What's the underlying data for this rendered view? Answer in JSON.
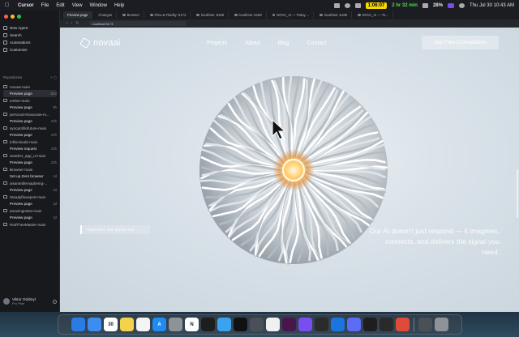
{
  "menubar": {
    "app_name": "Cursor",
    "items": [
      "File",
      "Edit",
      "View",
      "Window",
      "Help"
    ],
    "timer_yellow": "1:06:07",
    "timer_green": "2 hr 32 min",
    "battery_pct": "28%",
    "clock": "Thu Jul 30  10:43 AM"
  },
  "sidebar": {
    "nav": [
      {
        "label": "New Agent",
        "icon": "plus-icon"
      },
      {
        "label": "Search",
        "icon": "search-icon"
      },
      {
        "label": "Automations",
        "icon": "automation-icon"
      },
      {
        "label": "Customize",
        "icon": "customize-icon"
      }
    ],
    "repos_label": "Repositories",
    "repos": [
      {
        "name": "novaai-main",
        "sub": "Preview page",
        "age": "15m",
        "active": true
      },
      {
        "name": "ember-main",
        "sub": "Preview page",
        "age": "8h",
        "active": false
      },
      {
        "name": "personal-showcase-m...",
        "sub": "Preview page",
        "age": "22h",
        "active": false
      },
      {
        "name": "syncprofilofuture-main",
        "sub": "Preview page",
        "age": "22h",
        "active": false
      },
      {
        "name": "infiniclouds-main",
        "sub": "Preview request",
        "age": "22h",
        "active": false
      },
      {
        "name": "weather_app_ui-main",
        "sub": "Preview page",
        "age": "22h",
        "active": false
      },
      {
        "name": "Browser-main",
        "sub": "Set up Zero browser",
        "age": "1d",
        "active": false
      },
      {
        "name": "aisantedlemapbeing-...",
        "sub": "Preview page",
        "age": "2d",
        "active": false
      },
      {
        "name": "Steadyflowsport-main",
        "sub": "Preview page",
        "age": "2d",
        "active": false
      },
      {
        "name": "amazingrobot-main",
        "sub": "Preview page",
        "age": "2d",
        "active": false
      },
      {
        "name": "RedTheeMaster-main",
        "sub": "",
        "age": "",
        "active": false
      }
    ],
    "user": {
      "name": "Viktor Oddmyl",
      "plan": "Pro Plan"
    }
  },
  "browser": {
    "tabs": [
      "Preview page",
      "Changes",
      "Browser",
      "Flow & Fluidity :5173",
      "localhost :5189",
      "localhost :5189",
      "NOVA_AI — Today ...",
      "localhost :5188",
      "NOVA_AI — To..."
    ],
    "url": "localhost:5173"
  },
  "site": {
    "brand": "novaai",
    "nav_links": [
      "Projects",
      "About",
      "Blog",
      "Contact"
    ],
    "cta": "Get Free Consultation",
    "contact_button": "INQUIRY OR DEMAND",
    "tagline": "Our AI doesn't just respond — it imagines, connects, and delivers the signal you need."
  },
  "dock": {
    "apps": [
      {
        "name": "finder-icon",
        "color": "#2a7be4",
        "label": ""
      },
      {
        "name": "safari-icon",
        "color": "#3b8df0",
        "label": ""
      },
      {
        "name": "calendar-icon",
        "color": "#ffffff",
        "label": "30"
      },
      {
        "name": "notes-icon",
        "color": "#f4d24b",
        "label": ""
      },
      {
        "name": "reminders-icon",
        "color": "#f4f4f4",
        "label": ""
      },
      {
        "name": "app-store-icon",
        "color": "#1e8cf2",
        "label": "A"
      },
      {
        "name": "settings-icon",
        "color": "#8e9299",
        "label": ""
      },
      {
        "name": "notion-icon",
        "color": "#ffffff",
        "label": "N"
      },
      {
        "name": "figma-icon",
        "color": "#1e1e1e",
        "label": ""
      },
      {
        "name": "vpn-icon",
        "color": "#3aa3f0",
        "label": ""
      },
      {
        "name": "capcut-icon",
        "color": "#111111",
        "label": ""
      },
      {
        "name": "simulator-icon",
        "color": "#4a5058",
        "label": ""
      },
      {
        "name": "chrome-icon",
        "color": "#f0f0f0",
        "label": ""
      },
      {
        "name": "slack-icon",
        "color": "#4a154b",
        "label": ""
      },
      {
        "name": "obsidian-icon",
        "color": "#7a4df0",
        "label": ""
      },
      {
        "name": "copilot-icon",
        "color": "#2b2b2b",
        "label": ""
      },
      {
        "name": "xcode-icon",
        "color": "#1b75e0",
        "label": ""
      },
      {
        "name": "arc-icon",
        "color": "#5b6cf5",
        "label": ""
      },
      {
        "name": "perplexity-icon",
        "color": "#1e1e1e",
        "label": ""
      },
      {
        "name": "cursor-icon",
        "color": "#2a2a2a",
        "label": ""
      },
      {
        "name": "spark-icon",
        "color": "#e04a3a",
        "label": ""
      },
      {
        "name": "downloads-icon",
        "color": "#4a5058",
        "label": ""
      },
      {
        "name": "trash-icon",
        "color": "#8e9299",
        "label": ""
      }
    ]
  }
}
